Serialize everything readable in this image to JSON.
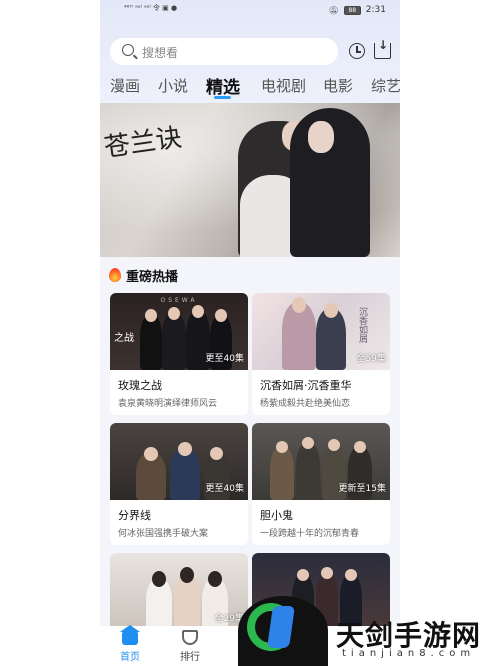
{
  "status_bar": {
    "left_glyphs": "⁴⁶ᴴ ᵃᵃˡ ᵃᵃˡ 令 ▣ ●",
    "battery": "88",
    "time": "2:31"
  },
  "search": {
    "placeholder": "搜想看"
  },
  "tabs": [
    {
      "label": "漫画"
    },
    {
      "label": "小说"
    },
    {
      "label": "精选",
      "active": true
    },
    {
      "label": "电视剧"
    },
    {
      "label": "电影"
    },
    {
      "label": "综艺"
    }
  ],
  "banner": {
    "calligraphy": "苍兰诀"
  },
  "section": {
    "title": "重磅热播"
  },
  "cards": [
    {
      "title": "玫瑰之战",
      "subtitle": "袁泉黄晓明演绎律师风云",
      "episodes": "更至40集",
      "thumb_label": "之战",
      "thumb_top": "OSEWA"
    },
    {
      "title": "沉香如屑·沉香重华",
      "subtitle": "杨紫成毅共赴绝美仙恋",
      "episodes": "全59集",
      "thumb_label": "沉香如屑"
    },
    {
      "title": "分界线",
      "subtitle": "何冰张国强携手破大案",
      "episodes": "更至40集"
    },
    {
      "title": "胆小鬼",
      "subtitle": "一段跨越十年的沉郁青春",
      "episodes": "更新至15集"
    },
    {
      "title": "",
      "subtitle": "",
      "episodes": "全29集"
    },
    {
      "title": "",
      "subtitle": "",
      "episodes": ""
    }
  ],
  "bottom_nav": [
    {
      "label": "首页",
      "icon": "home-icon",
      "active": true
    },
    {
      "label": "排行",
      "icon": "trophy-icon"
    }
  ],
  "watermark": {
    "text": "天剑手游网",
    "sub": "tianjian8.com"
  },
  "colors": {
    "accent": "#1f8ef1",
    "tab_underline": "#2a9df4",
    "fire": "#ff6a2b"
  }
}
